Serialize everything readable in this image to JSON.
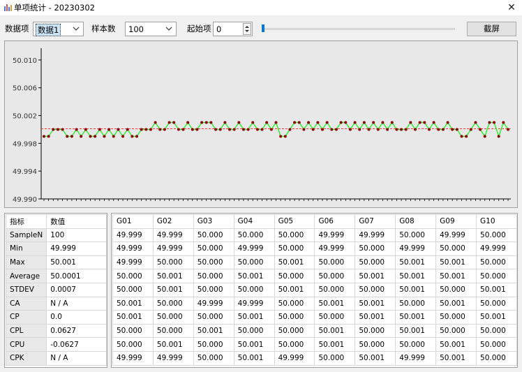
{
  "window": {
    "title": "单项统计 - 20230302",
    "icon": "bar-chart-icon",
    "close": "✕"
  },
  "toolbar": {
    "data_item_label": "数据项",
    "data_item_value": "数据1",
    "sample_count_label": "样本数",
    "sample_count_value": "100",
    "start_label": "起始项",
    "start_value": "0",
    "start_slider_fraction": 0,
    "screenshot_label": "截屏"
  },
  "chart_data": {
    "type": "line",
    "ylim": [
      49.99,
      50.012
    ],
    "yticks": [
      "50.010",
      "50.006",
      "50.002",
      "49.998",
      "49.994",
      "49.990"
    ],
    "ytick_values": [
      50.01,
      50.006,
      50.002,
      49.998,
      49.994,
      49.99
    ],
    "reference_line": 50.0001,
    "colors": {
      "line": "#33ee33",
      "reference": "#ff3333",
      "marker_high": "#8b0000",
      "marker_low": "#00008b",
      "background": "#e8e8e8"
    },
    "values": [
      49.999,
      49.999,
      50.0,
      50.0,
      50.0,
      49.999,
      49.999,
      50.0,
      49.999,
      50.0,
      49.999,
      49.999,
      50.0,
      49.999,
      50.0,
      49.999,
      50.0,
      49.999,
      50.0,
      49.999,
      49.999,
      50.0,
      50.0,
      50.0,
      50.001,
      50.0,
      50.0,
      50.001,
      50.001,
      50.0,
      50.0,
      50.001,
      50.0,
      50.0,
      50.001,
      50.001,
      50.001,
      50.0,
      50.0,
      50.001,
      50.0,
      50.0,
      50.001,
      50.0,
      50.0,
      50.001,
      50.0,
      50.0,
      50.001,
      50.0,
      50.001,
      49.999,
      49.999,
      50.0,
      50.001,
      50.001,
      50.0,
      50.001,
      50.0,
      50.001,
      50.0,
      50.001,
      50.0,
      50.0,
      50.001,
      50.001,
      50.0,
      50.001,
      50.0,
      50.001,
      50.0,
      50.001,
      50.0,
      50.001,
      50.0,
      50.001,
      50.0,
      50.0,
      50.0,
      50.001,
      50.0,
      50.001,
      50.001,
      50.0,
      50.001,
      50.0,
      50.0,
      50.001,
      50.0,
      50.0,
      49.999,
      49.999,
      50.0,
      50.001,
      50.0,
      49.999,
      50.001,
      50.001,
      49.999,
      50.001,
      50.0
    ]
  },
  "stats": {
    "headers": [
      "指标",
      "数值"
    ],
    "rows": [
      [
        "SampleN",
        "100"
      ],
      [
        "Min",
        "49.999"
      ],
      [
        "Max",
        "50.001"
      ],
      [
        "Average",
        "50.0001"
      ],
      [
        "STDEV",
        "0.0007"
      ],
      [
        "CA",
        "N / A"
      ],
      [
        "CP",
        "0.0"
      ],
      [
        "CPL",
        "0.0627"
      ],
      [
        "CPU",
        "-0.0627"
      ],
      [
        "CPK",
        "N / A"
      ]
    ]
  },
  "groups": {
    "headers": [
      "G01",
      "G02",
      "G03",
      "G04",
      "G05",
      "G06",
      "G07",
      "G08",
      "G09",
      "G10"
    ],
    "rows": [
      [
        "49.999",
        "49.999",
        "50.000",
        "50.000",
        "50.000",
        "49.999",
        "49.999",
        "50.000",
        "49.999",
        "50.000"
      ],
      [
        "49.999",
        "49.999",
        "50.000",
        "49.999",
        "50.000",
        "49.999",
        "50.000",
        "49.999",
        "50.000",
        "49.999"
      ],
      [
        "49.999",
        "50.000",
        "50.000",
        "50.000",
        "50.001",
        "50.000",
        "50.000",
        "50.001",
        "50.001",
        "50.000"
      ],
      [
        "50.000",
        "50.001",
        "50.000",
        "50.001",
        "50.000",
        "50.000",
        "50.001",
        "50.001",
        "50.001",
        "50.000"
      ],
      [
        "50.000",
        "50.001",
        "50.000",
        "50.000",
        "50.001",
        "50.000",
        "50.000",
        "50.001",
        "50.000",
        "50.001"
      ],
      [
        "50.001",
        "50.000",
        "49.999",
        "49.999",
        "50.000",
        "50.001",
        "50.001",
        "50.000",
        "50.001",
        "50.000"
      ],
      [
        "50.001",
        "50.000",
        "50.000",
        "50.001",
        "50.000",
        "50.000",
        "50.001",
        "50.001",
        "50.000",
        "50.001"
      ],
      [
        "50.000",
        "50.000",
        "50.001",
        "50.000",
        "50.000",
        "50.001",
        "50.000",
        "50.001",
        "50.000",
        "50.000"
      ],
      [
        "50.000",
        "50.001",
        "50.000",
        "50.001",
        "50.000",
        "50.001",
        "50.000",
        "50.000",
        "50.001",
        "50.000"
      ],
      [
        "49.999",
        "49.999",
        "50.000",
        "50.001",
        "49.999",
        "50.000",
        "50.001",
        "49.999",
        "50.001",
        "50.000"
      ]
    ]
  }
}
